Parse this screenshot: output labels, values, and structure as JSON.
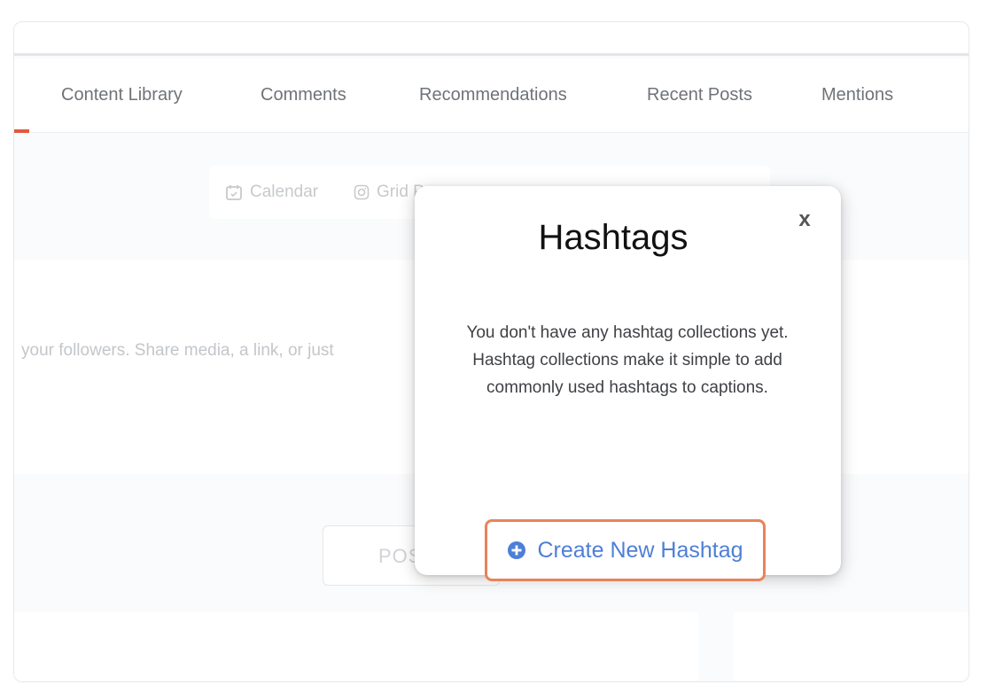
{
  "nav": {
    "tabs": [
      {
        "label": "Content Library"
      },
      {
        "label": "Comments"
      },
      {
        "label": "Recommendations"
      },
      {
        "label": "Recent Posts"
      },
      {
        "label": "Mentions"
      }
    ]
  },
  "view_switcher": {
    "items": [
      {
        "label": "Calendar",
        "icon": "calendar-icon"
      },
      {
        "label": "Grid P",
        "icon": "instagram-icon"
      }
    ]
  },
  "composer": {
    "placeholder": " your followers. Share media, a link, or just"
  },
  "post_button": {
    "label": "POS"
  },
  "modal": {
    "title": "Hashtags",
    "close_label": "x",
    "body": "You don't have any hashtag collections yet. Hashtag collections make it simple to add commonly used hashtags to captions.",
    "create_button": {
      "label": "Create New Hashtag",
      "icon": "plus-circle-icon"
    }
  },
  "colors": {
    "active_indicator": "#e25a3b",
    "highlight_border": "#e8835a",
    "link_blue": "#4e7fd6"
  }
}
